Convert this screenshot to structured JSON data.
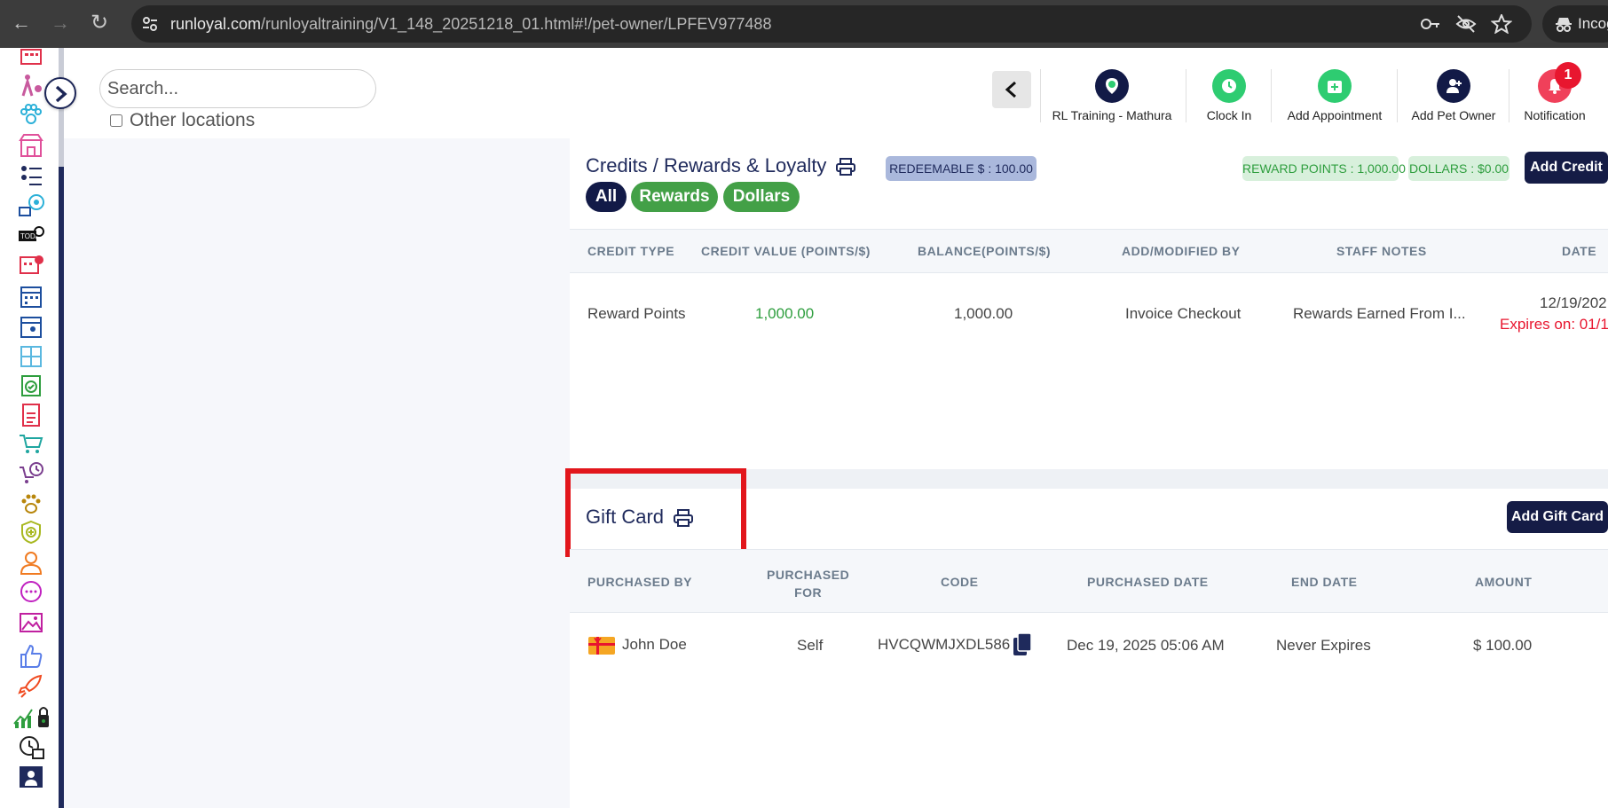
{
  "browser": {
    "url_host": "runloyal.com",
    "url_path": "/runloyaltraining/V1_148_20251218_01.html#!/pet-owner/LPFEV977488",
    "profile_label": "Incognito"
  },
  "left_panel": {
    "search_placeholder": "Search...",
    "other_locations_label": "Other locations"
  },
  "toolbar": {
    "items": [
      {
        "label": "RL Training - Mathura",
        "icon": "location-pin-icon",
        "color": "#121a47"
      },
      {
        "label": "Clock In",
        "icon": "clock-icon",
        "color": "#2ecc71"
      },
      {
        "label": "Add Appointment",
        "icon": "calendar-add-icon",
        "color": "#2ecc71"
      },
      {
        "label": "Add Pet Owner",
        "icon": "add-user-icon",
        "color": "#121a47"
      },
      {
        "label": "Notification",
        "icon": "bell-icon",
        "color": "#f0405a"
      }
    ],
    "notification_count": "1"
  },
  "credits": {
    "title": "Credits / Rewards & Loyalty",
    "redeemable": "REDEEMABLE $ : 100.00",
    "reward_points": "REWARD POINTS : 1,000.00",
    "dollars": "DOLLARS : $0.00",
    "add_button": "Add Credit",
    "filters": [
      "All",
      "Rewards",
      "Dollars"
    ],
    "columns": [
      "CREDIT TYPE",
      "CREDIT VALUE (POINTS/$)",
      "BALANCE(POINTS/$)",
      "ADD/MODIFIED BY",
      "STAFF NOTES",
      "DATE"
    ],
    "rows": [
      {
        "type": "Reward Points",
        "value": "1,000.00",
        "balance": "1,000.00",
        "modified_by": "Invoice Checkout",
        "notes": "Rewards Earned From I...",
        "date": "12/19/202",
        "expires": "Expires on: 01/1"
      }
    ]
  },
  "gift_card": {
    "title": "Gift Card",
    "add_button": "Add Gift Card",
    "columns": [
      "PURCHASED BY",
      "PURCHASED FOR",
      "CODE",
      "PURCHASED DATE",
      "END DATE",
      "AMOUNT"
    ],
    "purchased_for_line1": "PURCHASED",
    "purchased_for_line2": "FOR",
    "rows": [
      {
        "purchased_by": "John Doe",
        "purchased_for": "Self",
        "code": "HVCQWMJXDL586",
        "purchased_date": "Dec 19, 2025 05:06 AM",
        "end_date": "Never Expires",
        "amount": "$ 100.00"
      }
    ]
  },
  "colors": {
    "navy": "#1f2a5c",
    "green": "#43a047",
    "red": "#e2161c",
    "accent_value": "#2e9e3e"
  }
}
